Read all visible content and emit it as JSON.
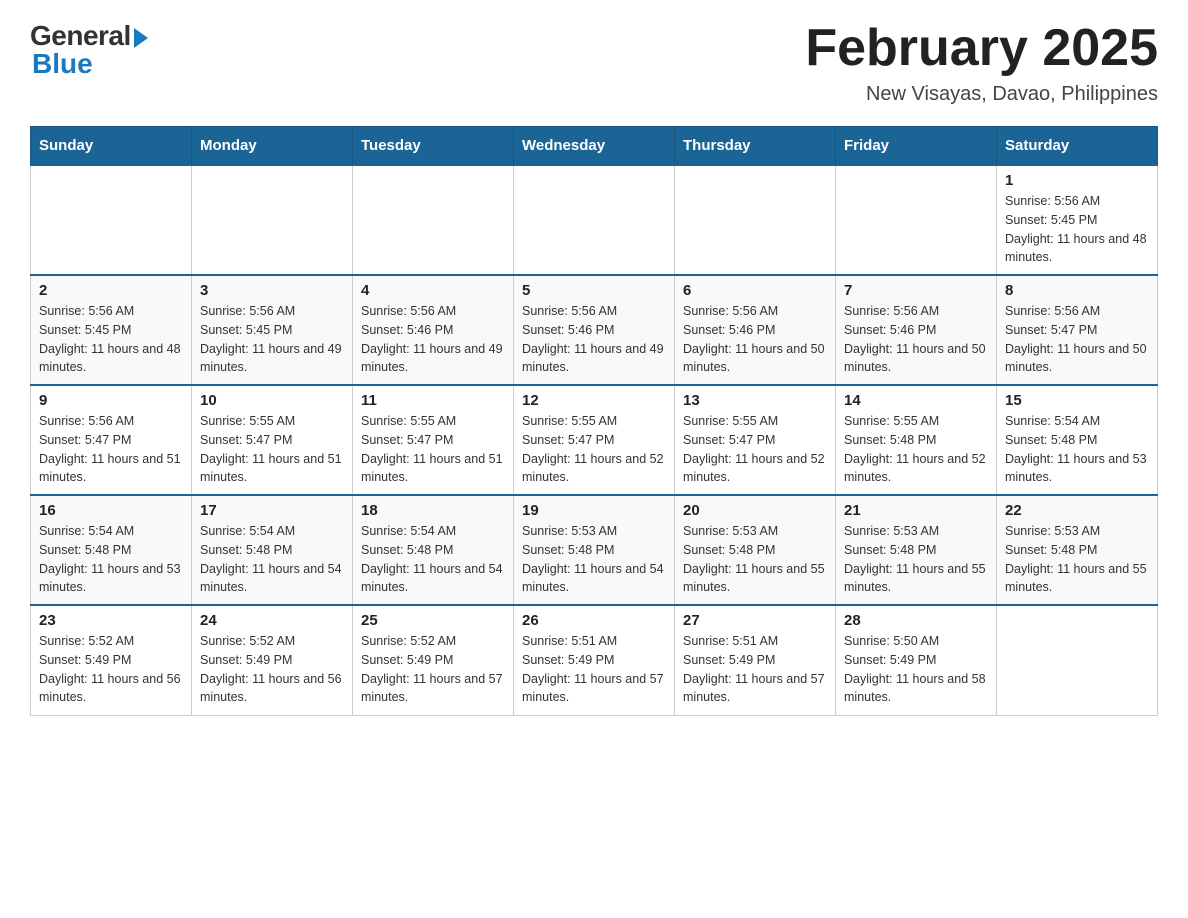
{
  "header": {
    "logo": {
      "general": "General",
      "blue": "Blue"
    },
    "title": "February 2025",
    "subtitle": "New Visayas, Davao, Philippines"
  },
  "weekdays": [
    "Sunday",
    "Monday",
    "Tuesday",
    "Wednesday",
    "Thursday",
    "Friday",
    "Saturday"
  ],
  "weeks": [
    [
      {
        "day": "",
        "sunrise": "",
        "sunset": "",
        "daylight": ""
      },
      {
        "day": "",
        "sunrise": "",
        "sunset": "",
        "daylight": ""
      },
      {
        "day": "",
        "sunrise": "",
        "sunset": "",
        "daylight": ""
      },
      {
        "day": "",
        "sunrise": "",
        "sunset": "",
        "daylight": ""
      },
      {
        "day": "",
        "sunrise": "",
        "sunset": "",
        "daylight": ""
      },
      {
        "day": "",
        "sunrise": "",
        "sunset": "",
        "daylight": ""
      },
      {
        "day": "1",
        "sunrise": "Sunrise: 5:56 AM",
        "sunset": "Sunset: 5:45 PM",
        "daylight": "Daylight: 11 hours and 48 minutes."
      }
    ],
    [
      {
        "day": "2",
        "sunrise": "Sunrise: 5:56 AM",
        "sunset": "Sunset: 5:45 PM",
        "daylight": "Daylight: 11 hours and 48 minutes."
      },
      {
        "day": "3",
        "sunrise": "Sunrise: 5:56 AM",
        "sunset": "Sunset: 5:45 PM",
        "daylight": "Daylight: 11 hours and 49 minutes."
      },
      {
        "day": "4",
        "sunrise": "Sunrise: 5:56 AM",
        "sunset": "Sunset: 5:46 PM",
        "daylight": "Daylight: 11 hours and 49 minutes."
      },
      {
        "day": "5",
        "sunrise": "Sunrise: 5:56 AM",
        "sunset": "Sunset: 5:46 PM",
        "daylight": "Daylight: 11 hours and 49 minutes."
      },
      {
        "day": "6",
        "sunrise": "Sunrise: 5:56 AM",
        "sunset": "Sunset: 5:46 PM",
        "daylight": "Daylight: 11 hours and 50 minutes."
      },
      {
        "day": "7",
        "sunrise": "Sunrise: 5:56 AM",
        "sunset": "Sunset: 5:46 PM",
        "daylight": "Daylight: 11 hours and 50 minutes."
      },
      {
        "day": "8",
        "sunrise": "Sunrise: 5:56 AM",
        "sunset": "Sunset: 5:47 PM",
        "daylight": "Daylight: 11 hours and 50 minutes."
      }
    ],
    [
      {
        "day": "9",
        "sunrise": "Sunrise: 5:56 AM",
        "sunset": "Sunset: 5:47 PM",
        "daylight": "Daylight: 11 hours and 51 minutes."
      },
      {
        "day": "10",
        "sunrise": "Sunrise: 5:55 AM",
        "sunset": "Sunset: 5:47 PM",
        "daylight": "Daylight: 11 hours and 51 minutes."
      },
      {
        "day": "11",
        "sunrise": "Sunrise: 5:55 AM",
        "sunset": "Sunset: 5:47 PM",
        "daylight": "Daylight: 11 hours and 51 minutes."
      },
      {
        "day": "12",
        "sunrise": "Sunrise: 5:55 AM",
        "sunset": "Sunset: 5:47 PM",
        "daylight": "Daylight: 11 hours and 52 minutes."
      },
      {
        "day": "13",
        "sunrise": "Sunrise: 5:55 AM",
        "sunset": "Sunset: 5:47 PM",
        "daylight": "Daylight: 11 hours and 52 minutes."
      },
      {
        "day": "14",
        "sunrise": "Sunrise: 5:55 AM",
        "sunset": "Sunset: 5:48 PM",
        "daylight": "Daylight: 11 hours and 52 minutes."
      },
      {
        "day": "15",
        "sunrise": "Sunrise: 5:54 AM",
        "sunset": "Sunset: 5:48 PM",
        "daylight": "Daylight: 11 hours and 53 minutes."
      }
    ],
    [
      {
        "day": "16",
        "sunrise": "Sunrise: 5:54 AM",
        "sunset": "Sunset: 5:48 PM",
        "daylight": "Daylight: 11 hours and 53 minutes."
      },
      {
        "day": "17",
        "sunrise": "Sunrise: 5:54 AM",
        "sunset": "Sunset: 5:48 PM",
        "daylight": "Daylight: 11 hours and 54 minutes."
      },
      {
        "day": "18",
        "sunrise": "Sunrise: 5:54 AM",
        "sunset": "Sunset: 5:48 PM",
        "daylight": "Daylight: 11 hours and 54 minutes."
      },
      {
        "day": "19",
        "sunrise": "Sunrise: 5:53 AM",
        "sunset": "Sunset: 5:48 PM",
        "daylight": "Daylight: 11 hours and 54 minutes."
      },
      {
        "day": "20",
        "sunrise": "Sunrise: 5:53 AM",
        "sunset": "Sunset: 5:48 PM",
        "daylight": "Daylight: 11 hours and 55 minutes."
      },
      {
        "day": "21",
        "sunrise": "Sunrise: 5:53 AM",
        "sunset": "Sunset: 5:48 PM",
        "daylight": "Daylight: 11 hours and 55 minutes."
      },
      {
        "day": "22",
        "sunrise": "Sunrise: 5:53 AM",
        "sunset": "Sunset: 5:48 PM",
        "daylight": "Daylight: 11 hours and 55 minutes."
      }
    ],
    [
      {
        "day": "23",
        "sunrise": "Sunrise: 5:52 AM",
        "sunset": "Sunset: 5:49 PM",
        "daylight": "Daylight: 11 hours and 56 minutes."
      },
      {
        "day": "24",
        "sunrise": "Sunrise: 5:52 AM",
        "sunset": "Sunset: 5:49 PM",
        "daylight": "Daylight: 11 hours and 56 minutes."
      },
      {
        "day": "25",
        "sunrise": "Sunrise: 5:52 AM",
        "sunset": "Sunset: 5:49 PM",
        "daylight": "Daylight: 11 hours and 57 minutes."
      },
      {
        "day": "26",
        "sunrise": "Sunrise: 5:51 AM",
        "sunset": "Sunset: 5:49 PM",
        "daylight": "Daylight: 11 hours and 57 minutes."
      },
      {
        "day": "27",
        "sunrise": "Sunrise: 5:51 AM",
        "sunset": "Sunset: 5:49 PM",
        "daylight": "Daylight: 11 hours and 57 minutes."
      },
      {
        "day": "28",
        "sunrise": "Sunrise: 5:50 AM",
        "sunset": "Sunset: 5:49 PM",
        "daylight": "Daylight: 11 hours and 58 minutes."
      },
      {
        "day": "",
        "sunrise": "",
        "sunset": "",
        "daylight": ""
      }
    ]
  ]
}
